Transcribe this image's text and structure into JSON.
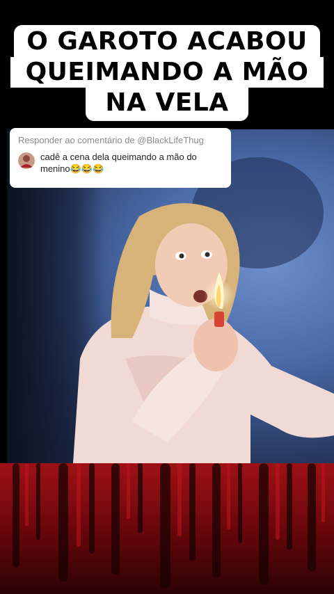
{
  "title": {
    "lines": [
      "O GAROTO ACABOU",
      "QUEIMANDO A MÃO",
      "NA VELA"
    ]
  },
  "comment": {
    "reply_header": "Responder ao comentário de @BlackLifeThug",
    "text_line1": "cadê a cena dela queimando a mão do",
    "text_line2": "menino😂😂😂",
    "avatar_icon": "user-avatar-icon"
  },
  "colors": {
    "background": "#000000",
    "title_box": "#ffffff",
    "title_text": "#000000",
    "video_wall": "#4a6aa8",
    "bottom_red": "#8e0e12"
  }
}
